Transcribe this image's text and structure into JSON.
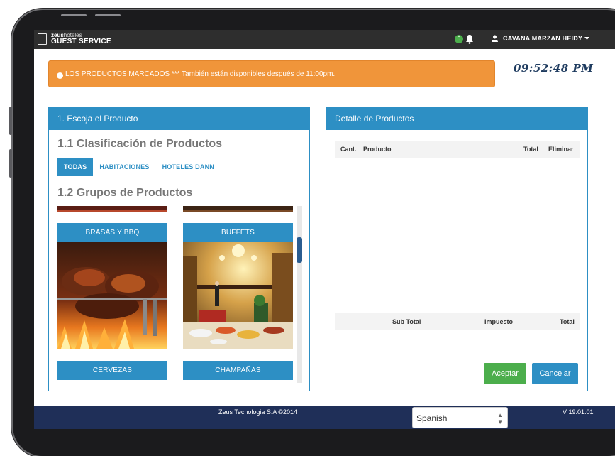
{
  "brand": {
    "line1_bold": "zeus",
    "line1_light": "hoteles",
    "line2": "GUEST SERVICE"
  },
  "header": {
    "notifications": "0",
    "user_name": "CAVANA MARZAN HEIDY"
  },
  "alert": {
    "text": "LOS PRODUCTOS MARCADOS *** También están disponibles después de 11:00pm.."
  },
  "clock": "09:52:48 PM",
  "left_panel": {
    "title": "1. Escoja el Producto",
    "classification_heading": "1.1 Clasificación de Productos",
    "filters": [
      "TODAS",
      "HABITACIONES",
      "HOTELES DANN"
    ],
    "groups_heading": "1.2 Grupos de Productos",
    "groups": [
      "BRASAS Y BBQ",
      "BUFFETS",
      "CERVEZAS",
      "CHAMPAÑAS"
    ]
  },
  "right_panel": {
    "title": "Detalle de Productos",
    "columns": [
      "Cant.",
      "Producto",
      "Total",
      "Eliminar"
    ],
    "summary_columns": [
      "Sub Total",
      "Impuesto",
      "Total"
    ],
    "accept_label": "Aceptar",
    "cancel_label": "Cancelar"
  },
  "footer": {
    "copyright": "Zeus Tecnologia S.A ©2014",
    "language": "Spanish",
    "version": "V 19.01.01"
  },
  "colors": {
    "primary": "#2d8fc4",
    "alert": "#f0953a",
    "success": "#4cae4c",
    "footer": "#1f2f58"
  }
}
